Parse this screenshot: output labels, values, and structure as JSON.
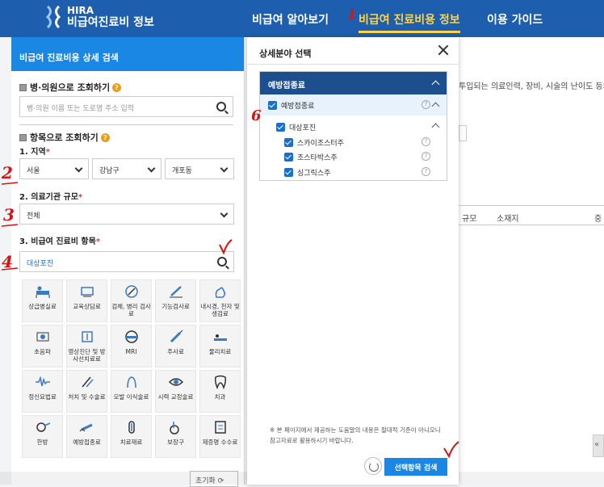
{
  "header": {
    "logo_en": "HIRA",
    "logo_ko": "비급여진료비 정보",
    "nav": [
      "비급여 알아보기",
      "비급여 진료비용 정보",
      "이용 가이드"
    ]
  },
  "panel": {
    "title": "비급여 진료비용 상세 검색",
    "hospital_section": "병·의원으로 조회하기",
    "hospital_placeholder": "병·의원 이름 또는 도로명 주소 입력",
    "item_section": "항목으로 조회하기",
    "region_label": "1. 지역",
    "region": [
      "서울",
      "강남구",
      "개포동"
    ],
    "scale_label": "2. 의료기관 규모",
    "scale_value": "전체",
    "item_label": "3. 비급여 진료비 항목",
    "item_value": "대상포진",
    "tiles": [
      "상급병실료",
      "교육상담료",
      "검체, 병리 검사료",
      "기능검사료",
      "내시경, 천자 및 생검료",
      "초음파",
      "영상진단 및 방사선치료료",
      "MRI",
      "주사료",
      "물리치료",
      "정신요법료",
      "처치 및 수술료",
      "모발 이식술료",
      "시력 교정술료",
      "치과",
      "한방",
      "예방접종료",
      "치료재료",
      "보장구",
      "제증명 수수료"
    ],
    "reset": "초기화"
  },
  "modal": {
    "title": "상세분야 선택",
    "group": "예방접종료",
    "level1": "예방접종료",
    "level2": "대상포진",
    "items": [
      "스카이조스터주",
      "조스타박스주",
      "싱그릭스주"
    ],
    "notice": "※ 본 페이지에서 제공하는 도움말의 내용은 절대적 기준이 아니오니참고자료로 활용하시기 바랍니다.",
    "apply": "선택항목 검색"
  },
  "background": {
    "intro_text": "투입되는 의료인력, 장비, 시술의 난이도 등의",
    "col_scale": "규모",
    "col_location": "소재지",
    "col_more": "중"
  },
  "annotations": [
    "1",
    "2",
    "3",
    "4",
    "6"
  ]
}
